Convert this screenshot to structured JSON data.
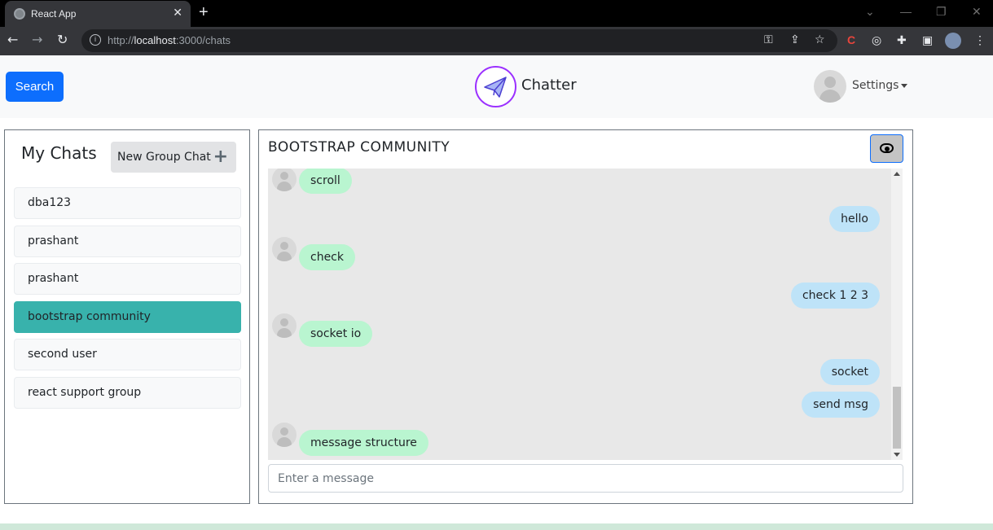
{
  "browser": {
    "tab_title": "React App",
    "tab_close": "✕",
    "new_tab": "+",
    "url_prefix": "http://",
    "url_host": "localhost",
    "url_rest": ":3000/chats",
    "back": "←",
    "forward": "→",
    "reload": "↻",
    "info": "i"
  },
  "header": {
    "search_label": "Search",
    "brand": "Chatter",
    "settings_label": "Settings"
  },
  "my_chats": {
    "title": "My Chats",
    "new_group_label": "New Group Chat",
    "new_group_plus": "+",
    "items": [
      {
        "label": "dba123",
        "active": false
      },
      {
        "label": "prashant",
        "active": false
      },
      {
        "label": "prashant",
        "active": false
      },
      {
        "label": "bootstrap community",
        "active": true
      },
      {
        "label": "second user",
        "active": false
      },
      {
        "label": "react support group",
        "active": false
      }
    ]
  },
  "chat": {
    "title": "BOOTSTRAP COMMUNITY",
    "messages": [
      {
        "text": "scroll",
        "sender": "other"
      },
      {
        "text": "hello",
        "sender": "me"
      },
      {
        "text": "check",
        "sender": "other"
      },
      {
        "text": "check 1 2 3",
        "sender": "me"
      },
      {
        "text": "socket io",
        "sender": "other"
      },
      {
        "text": "socket",
        "sender": "me"
      },
      {
        "text": "send msg",
        "sender": "me"
      },
      {
        "text": "message structure",
        "sender": "other"
      }
    ],
    "input_placeholder": "Enter a message"
  },
  "colors": {
    "primary": "#0d6efd",
    "active_chat": "#38b2ac",
    "incoming_bubble": "#b9f5d0",
    "outgoing_bubble": "#bee3f8"
  }
}
